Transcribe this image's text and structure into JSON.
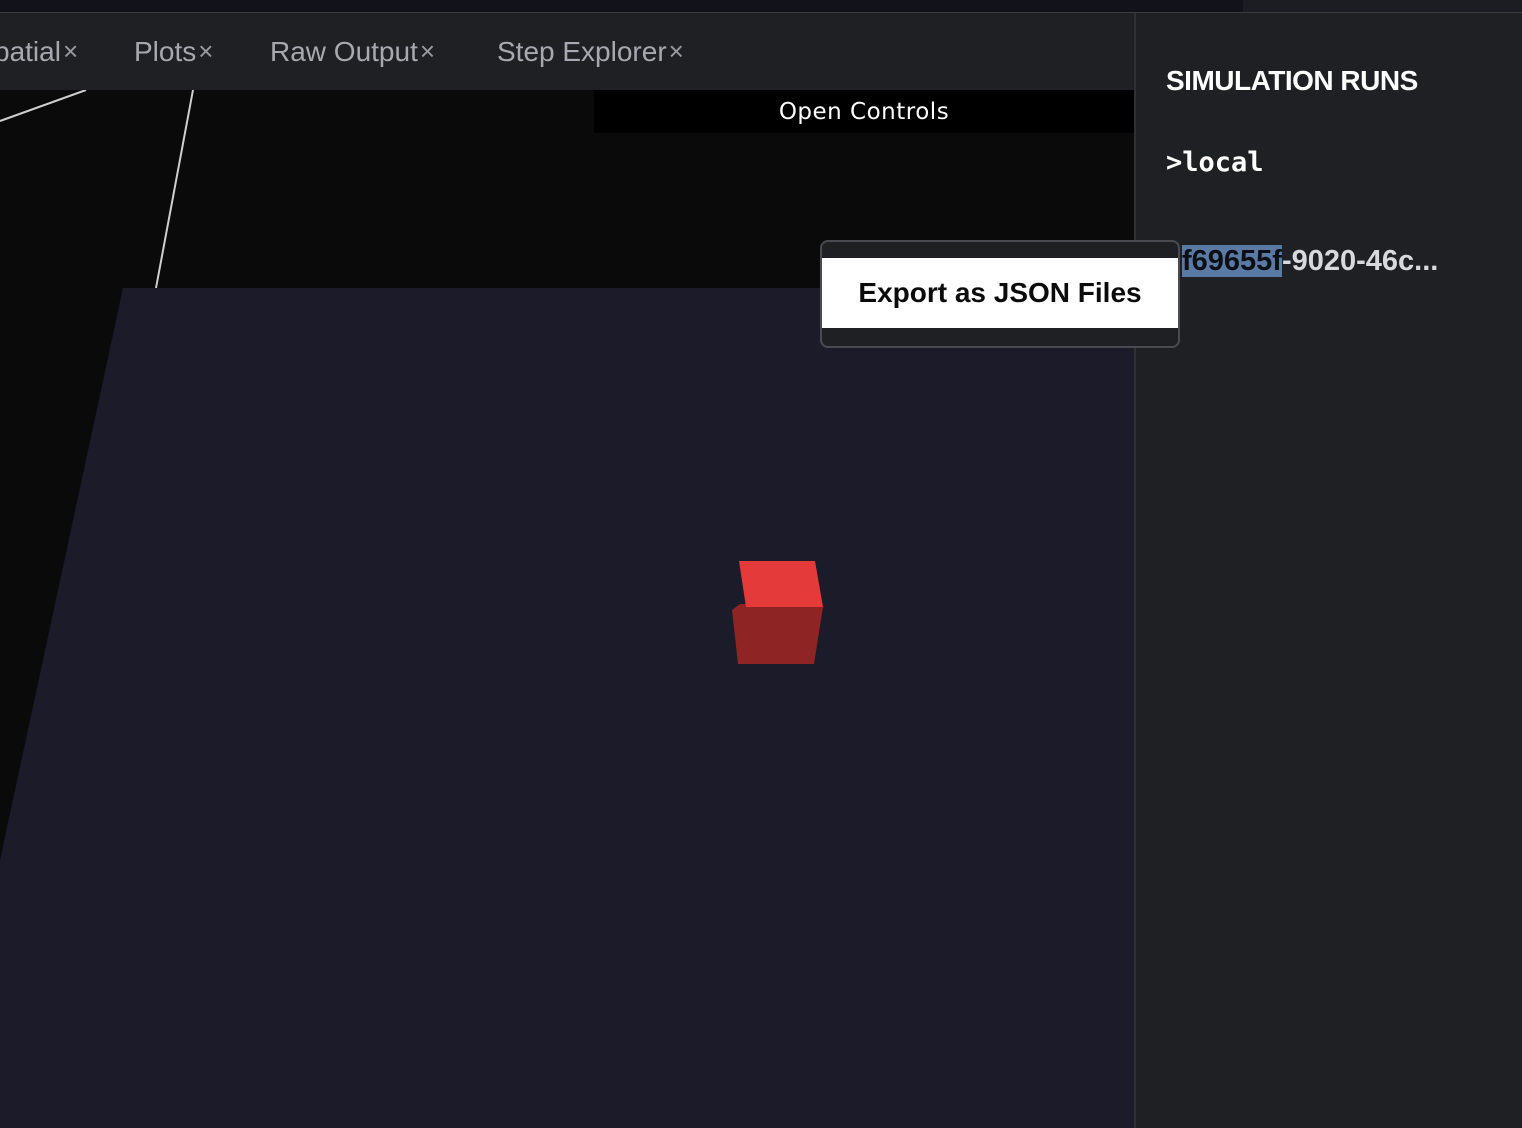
{
  "tabs": [
    {
      "label": "patial",
      "close": "×"
    },
    {
      "label": "Plots",
      "close": "×"
    },
    {
      "label": "Raw Output",
      "close": "×"
    },
    {
      "label": "Step Explorer",
      "close": "×"
    }
  ],
  "viewport": {
    "open_controls_label": "Open Controls",
    "floor_color": "#1b1b29",
    "cube_top_color": "#e53a3a",
    "cube_side_color": "#8f2424"
  },
  "sidebar": {
    "title": "SIMULATION RUNS",
    "group": ">local",
    "run": {
      "selected_part": "f69655f",
      "rest": "-9020-46c..."
    }
  },
  "popup": {
    "export_label": "Export as JSON Files"
  }
}
